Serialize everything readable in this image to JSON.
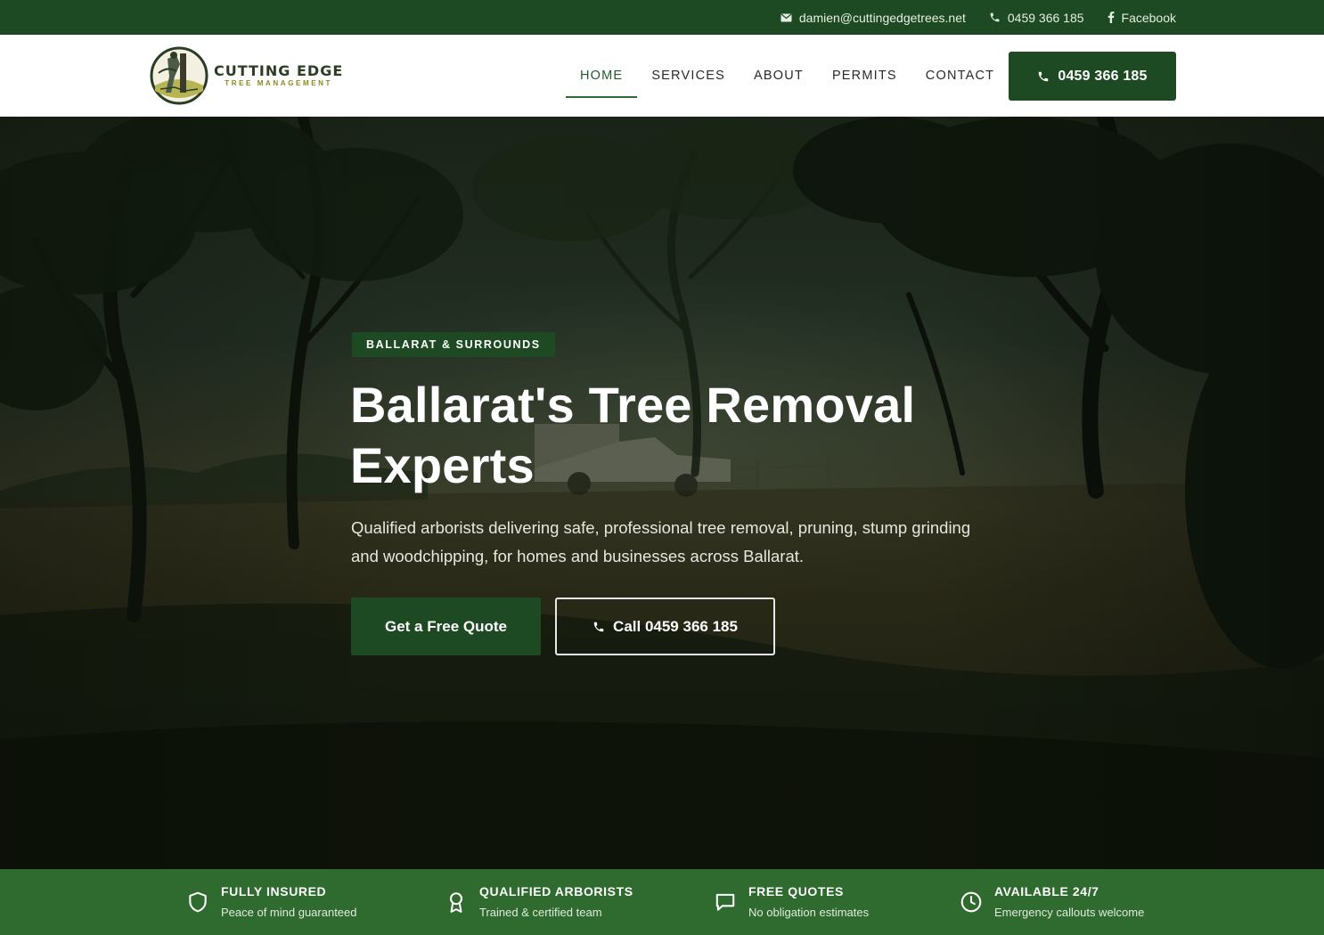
{
  "topbar": {
    "email": "damien@cuttingedgetrees.net",
    "phone": "0459 366 185",
    "social": "Facebook",
    "icons": [
      "mail-icon",
      "phone-icon",
      "facebook-icon"
    ]
  },
  "logo": {
    "main": "CUTTING EDGE",
    "sub": "TREE MANAGEMENT"
  },
  "nav": {
    "items": [
      {
        "label": "HOME",
        "active": true
      },
      {
        "label": "SERVICES"
      },
      {
        "label": "ABOUT"
      },
      {
        "label": "PERMITS"
      },
      {
        "label": "CONTACT"
      }
    ],
    "call_label": "0459 366 185"
  },
  "hero": {
    "badge": "BALLARAT & SURROUNDS",
    "title_line1": "Ballarat's Tree Removal",
    "title_line2": "Experts",
    "subtitle": "Qualified arborists delivering safe, professional tree removal, pruning, stump grinding and woodchipping, for homes and businesses across Ballarat.",
    "quote_button": "Get a Free Quote",
    "call_button": "Call 0459 366 185"
  },
  "features": [
    {
      "title": "FULLY INSURED",
      "subtitle": "Peace of mind guaranteed",
      "icon": "shield-icon"
    },
    {
      "title": "QUALIFIED ARBORISTS",
      "subtitle": "Trained & certified team",
      "icon": "award-icon"
    },
    {
      "title": "FREE QUOTES",
      "subtitle": "No obligation estimates",
      "icon": "chat-icon"
    },
    {
      "title": "AVAILABLE 24/7",
      "subtitle": "Emergency callouts welcome",
      "icon": "clock-icon"
    }
  ],
  "colors": {
    "brand_dark": "#1d4a22",
    "brand_strip": "#2f6b2f",
    "header_bg": "#ffffff",
    "logo_accent": "#8a8a20"
  }
}
